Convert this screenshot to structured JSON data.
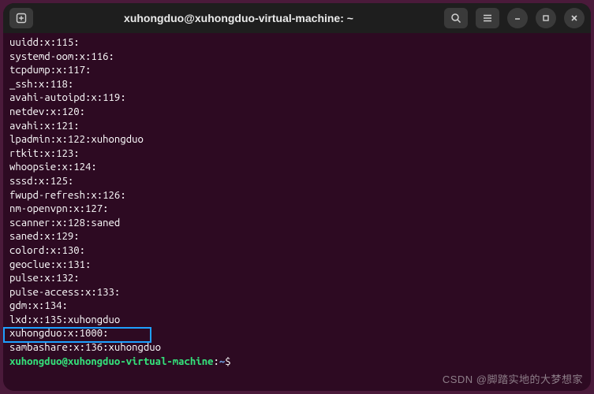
{
  "titlebar": {
    "title": "xuhongduo@xuhongduo-virtual-machine: ~"
  },
  "terminal": {
    "lines": [
      "uuidd:x:115:",
      "systemd-oom:x:116:",
      "tcpdump:x:117:",
      "_ssh:x:118:",
      "avahi-autoipd:x:119:",
      "netdev:x:120:",
      "avahi:x:121:",
      "lpadmin:x:122:xuhongduo",
      "rtkit:x:123:",
      "whoopsie:x:124:",
      "sssd:x:125:",
      "fwupd-refresh:x:126:",
      "nm-openvpn:x:127:",
      "scanner:x:128:saned",
      "saned:x:129:",
      "colord:x:130:",
      "geoclue:x:131:",
      "pulse:x:132:",
      "pulse-access:x:133:",
      "gdm:x:134:",
      "lxd:x:135:xuhongduo",
      "xuhongduo:x:1000:",
      "sambashare:x:136:xuhongduo"
    ],
    "prompt": {
      "user_host": "xuhongduo@xuhongduo-virtual-machine",
      "separator": ":",
      "path": "~",
      "symbol": "$"
    },
    "highlight_line_index": 21
  },
  "watermark": "CSDN @脚踏实地的大梦想家"
}
